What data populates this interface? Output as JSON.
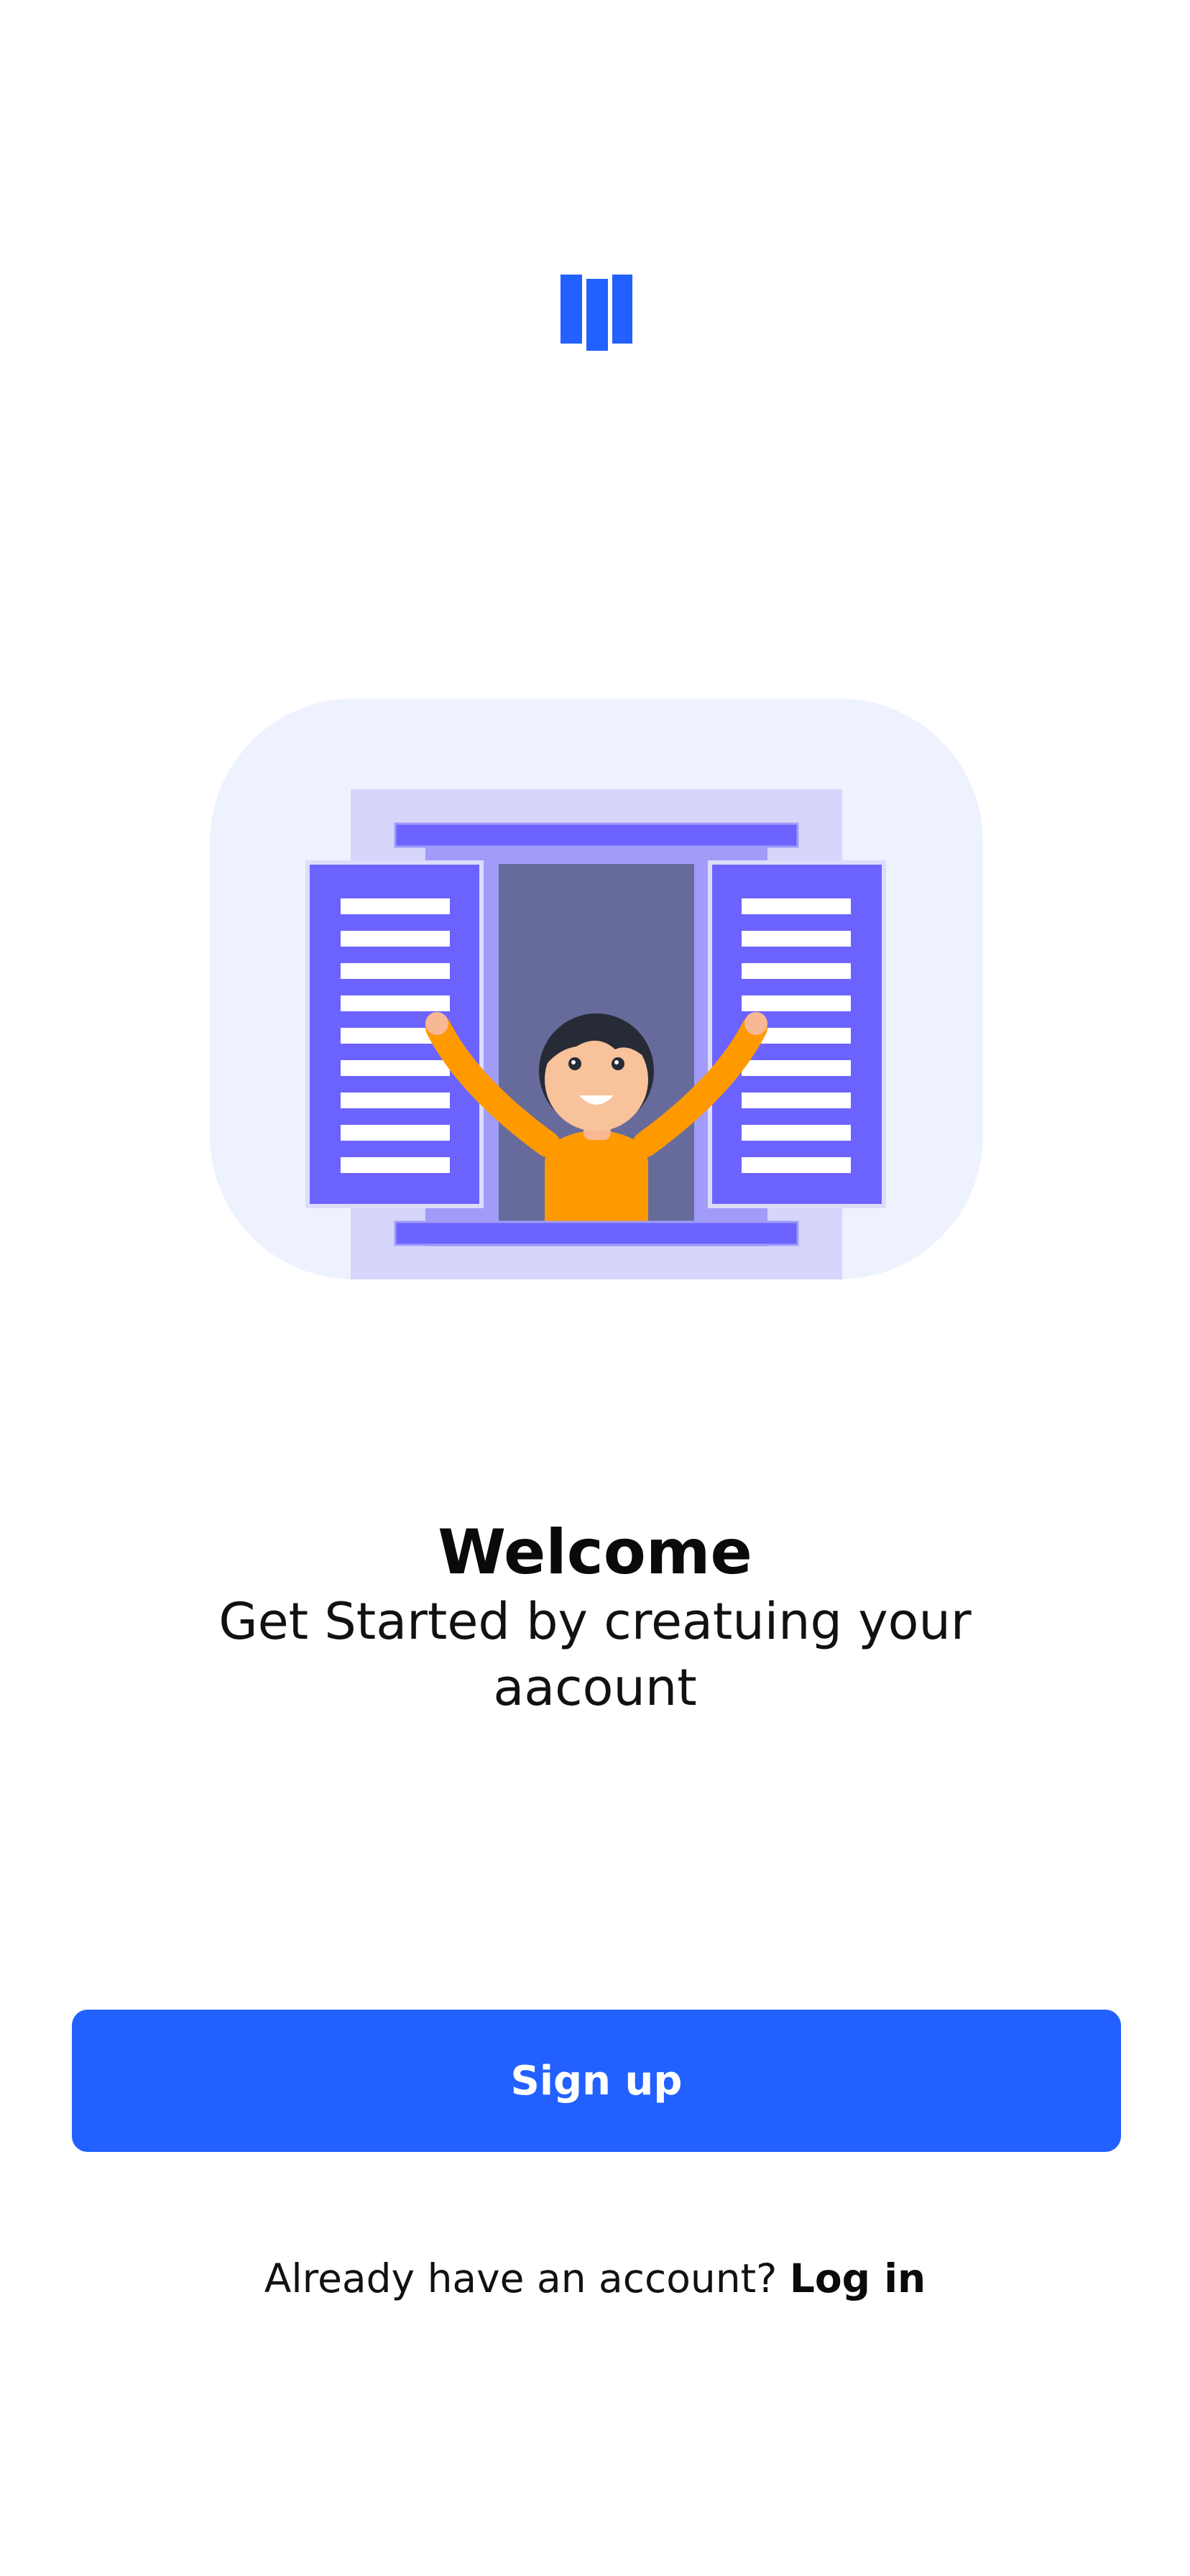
{
  "onboarding": {
    "title": "Welcome",
    "subtitle": "Get Started by creatuing your aacount"
  },
  "actions": {
    "signup_label": "Sign up",
    "login_prompt": "Already have an account?",
    "login_link": "Log in"
  },
  "colors": {
    "primary": "#2260ff",
    "illustration_bg": "#eef2ff",
    "shutter": "#6c63ff",
    "person_shirt": "#ff9900"
  },
  "icons": {
    "logo": "bars-logo-icon",
    "illustration": "person-at-window-illustration"
  }
}
